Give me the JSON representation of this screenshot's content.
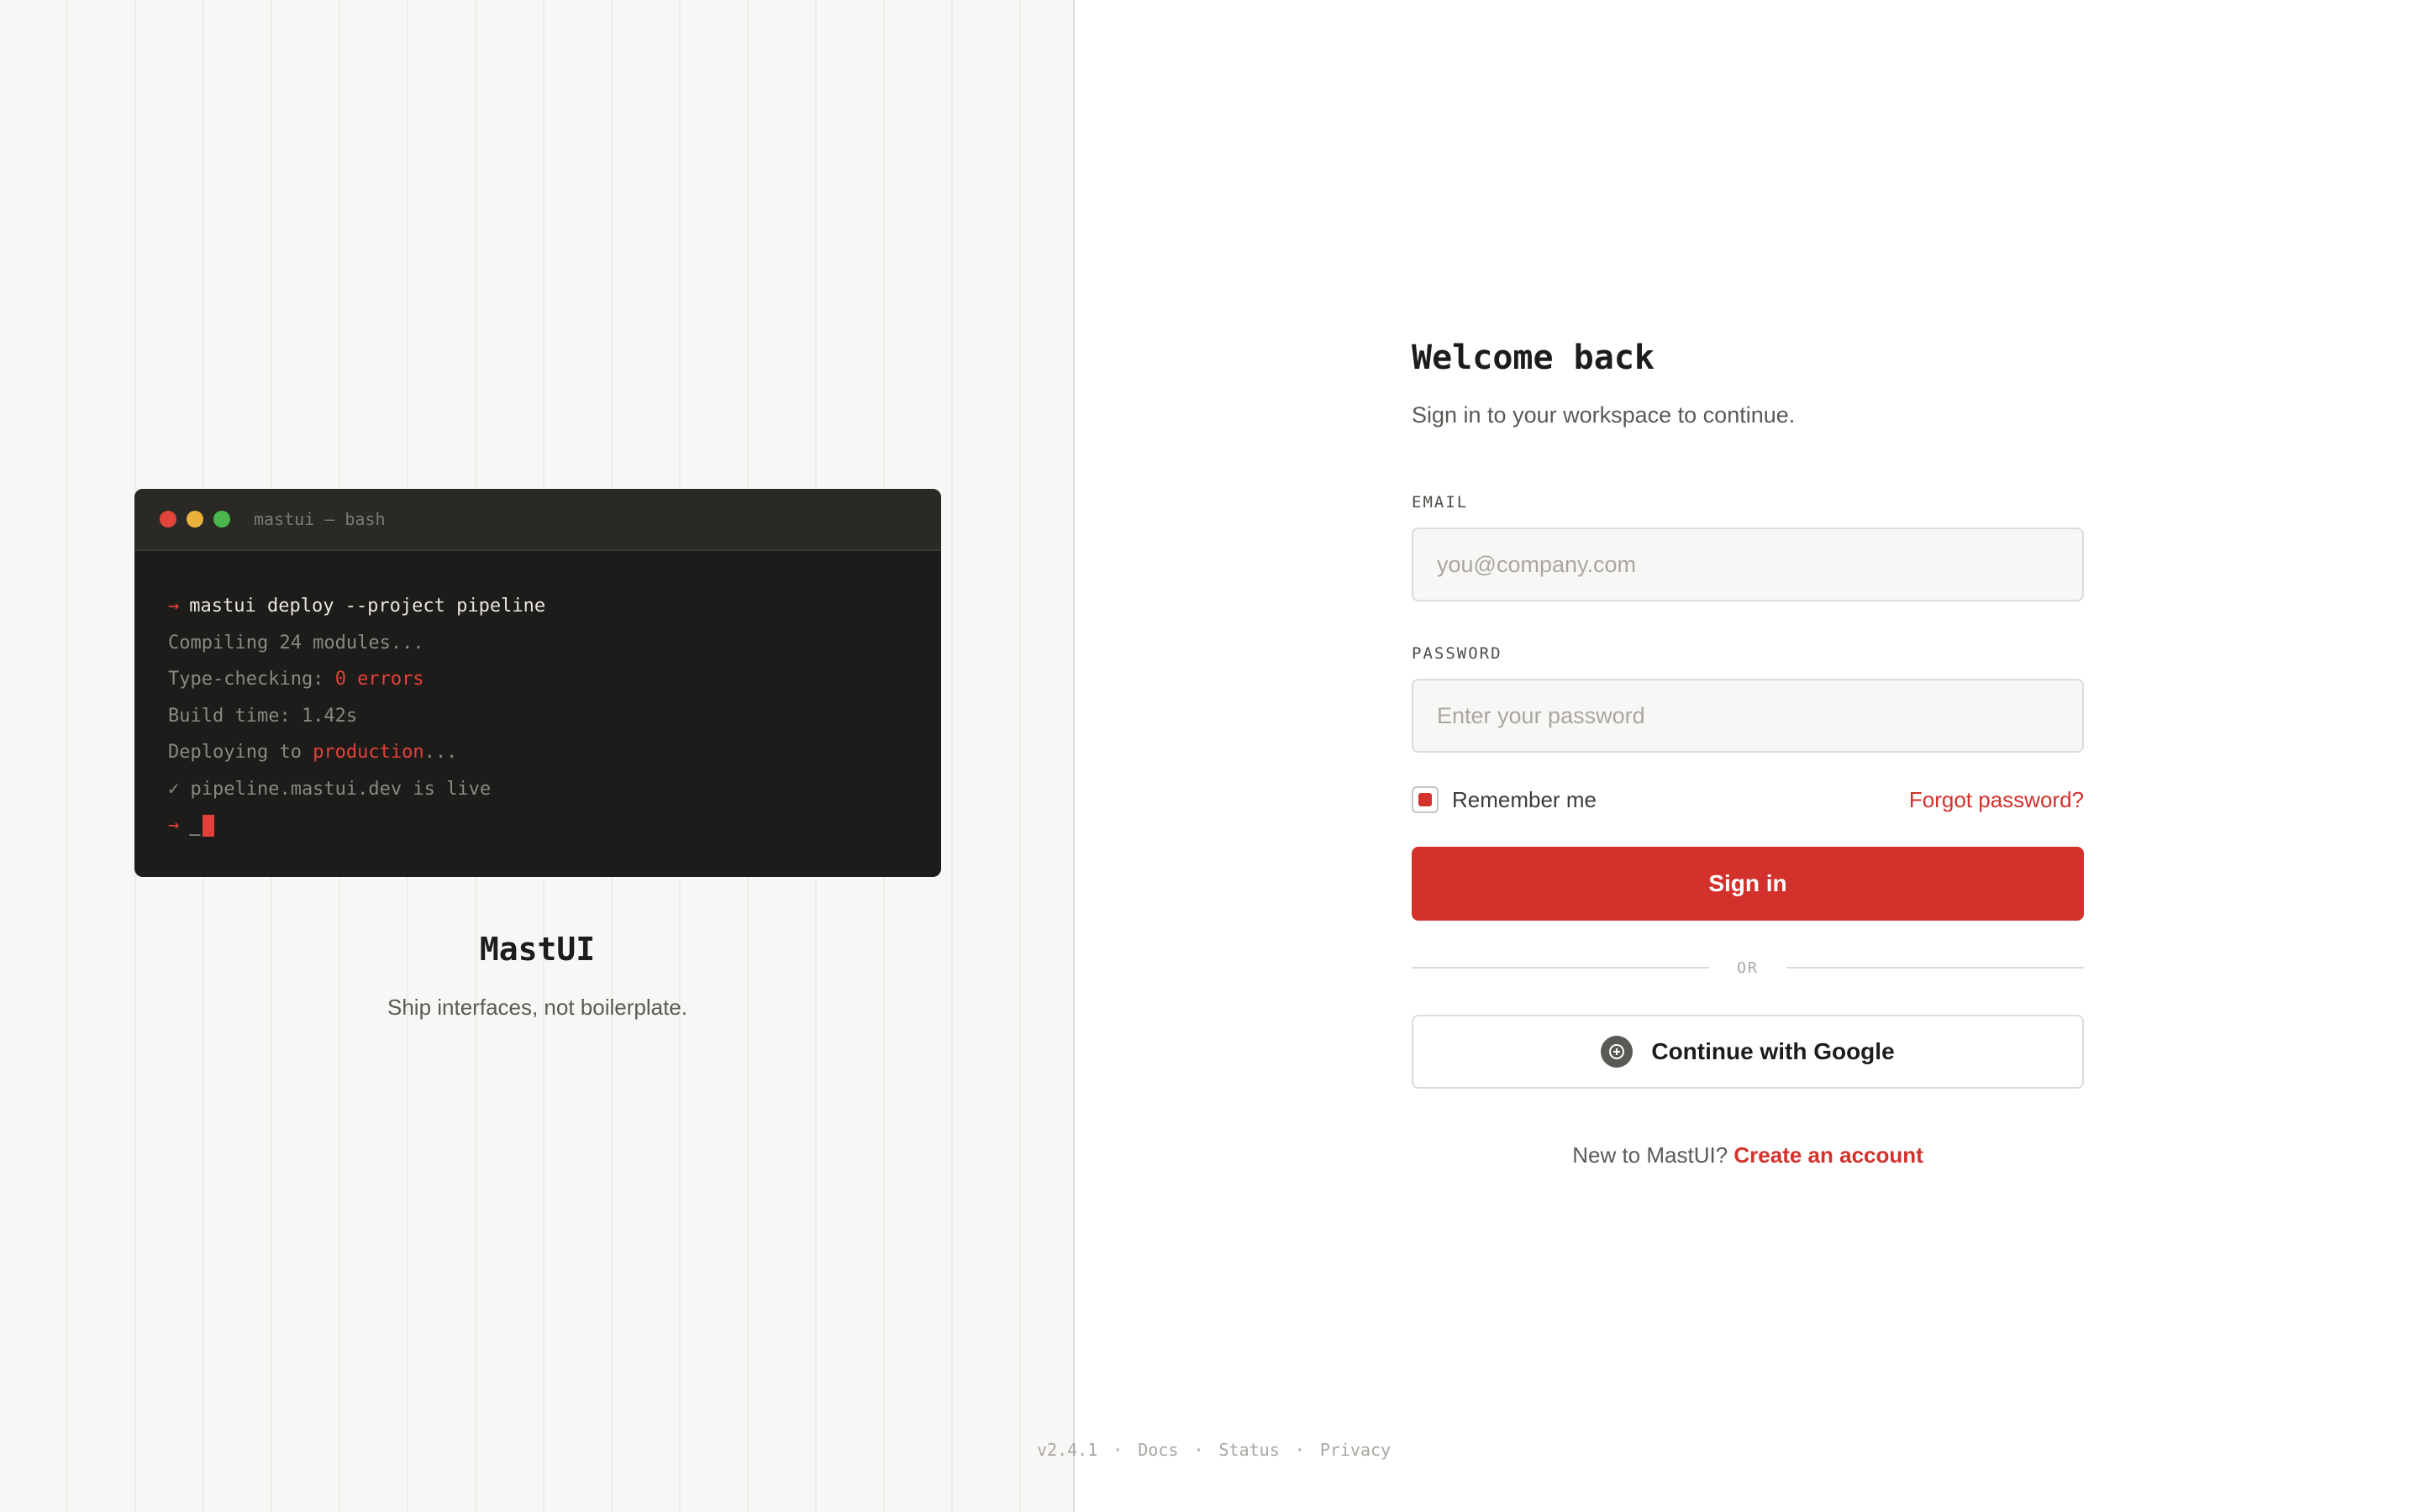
{
  "brand": {
    "name": "MastUI",
    "tagline": "Ship interfaces, not boilerplate."
  },
  "terminal": {
    "title": "mastui — bash",
    "command": "mastui deploy --project pipeline",
    "line_compiling": "Compiling 24 modules...",
    "line_typecheck_prefix": "Type-checking: ",
    "line_typecheck_highlight": "0 errors",
    "line_build": "Build time: 1.42s",
    "line_deploy_prefix": "Deploying to ",
    "line_deploy_highlight": "production",
    "line_deploy_suffix": "...",
    "line_live": "✓ pipeline.mastui.dev is live",
    "prompt_symbol": "→",
    "cursor_text": "_"
  },
  "form": {
    "title": "Welcome back",
    "subtitle": "Sign in to your workspace to continue.",
    "email_label": "EMAIL",
    "email_placeholder": "you@company.com",
    "email_value": "",
    "password_label": "PASSWORD",
    "password_placeholder": "Enter your password",
    "password_value": "",
    "remember_label": "Remember me",
    "remember_checked": true,
    "forgot_label": "Forgot password?",
    "sign_in_label": "Sign in",
    "or_label": "OR",
    "google_label": "Continue with Google",
    "signup_prompt": "New to MastUI?",
    "signup_link": "Create an account"
  },
  "footer": {
    "version": "v2.4.1",
    "separator": "·",
    "docs": "Docs",
    "status": "Status",
    "privacy": "Privacy"
  },
  "colors": {
    "accent": "#d3312b",
    "terminal_bg": "#1d1c1a",
    "panel_bg": "#f8f7f5"
  }
}
